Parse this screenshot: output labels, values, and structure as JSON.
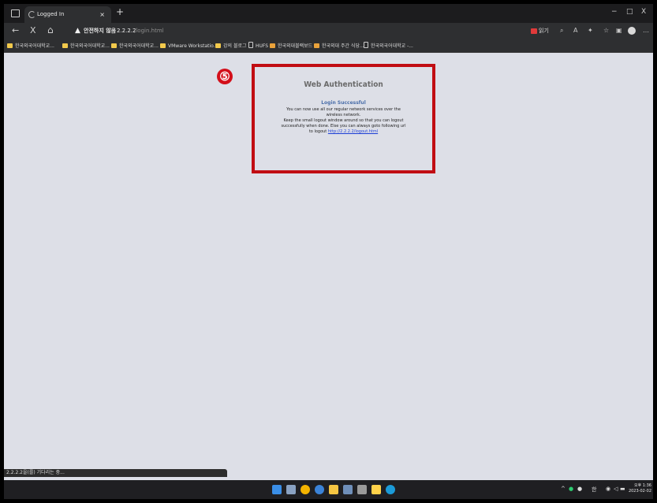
{
  "tab": {
    "title": "Logged In",
    "close": "×",
    "new": "+"
  },
  "window_controls": {
    "minimize": "−",
    "maximize": "□",
    "close": "X"
  },
  "nav": {
    "back": "←",
    "stop": "X",
    "home": "⌂",
    "not_secure": "안전하지 않음",
    "separator": "|",
    "url_host": "2.2.2.2",
    "url_path": "/login.html",
    "reading_label": "읽기"
  },
  "bookmarks": [
    {
      "label": "한국외국어대학교...",
      "icon": "folder"
    },
    {
      "label": "한국외국어대학교...",
      "icon": "folder"
    },
    {
      "label": "한국외국어대학교...",
      "icon": "folder"
    },
    {
      "label": "VMware Workstatio...",
      "icon": "folder"
    },
    {
      "label": "강의 블로그",
      "icon": "folder"
    },
    {
      "label": "HUFS",
      "icon": "page"
    },
    {
      "label": "한국외대블랙보드",
      "icon": "image"
    },
    {
      "label": "한국외대 주간 식당...",
      "icon": "image"
    },
    {
      "label": "한국외국어대학교 -...",
      "icon": "page"
    }
  ],
  "annotation": {
    "number": "⑤"
  },
  "auth": {
    "title": "Web Authentication",
    "subtitle": "Login Successful",
    "line1": "You can now use all our regular network services over the",
    "line2": "wireless network.",
    "line3": "Keep the small logout window around so that you can logout",
    "line4": "successfully when done. Else you can always goto following url",
    "line5_prefix": "to logout",
    "logout_url": "http://2.2.2.2/logout.html"
  },
  "status": {
    "text": "2.2.2.2을(를) 기다리는 중..."
  },
  "clock": {
    "time": "오후 1:36",
    "date": "2023-02-02"
  },
  "tray": {
    "lang": "한",
    "chevron": "^"
  },
  "colors": {
    "annotation_red": "#c10d13",
    "page_bg": "#dddfe7",
    "link_blue": "#1a3dd6"
  }
}
